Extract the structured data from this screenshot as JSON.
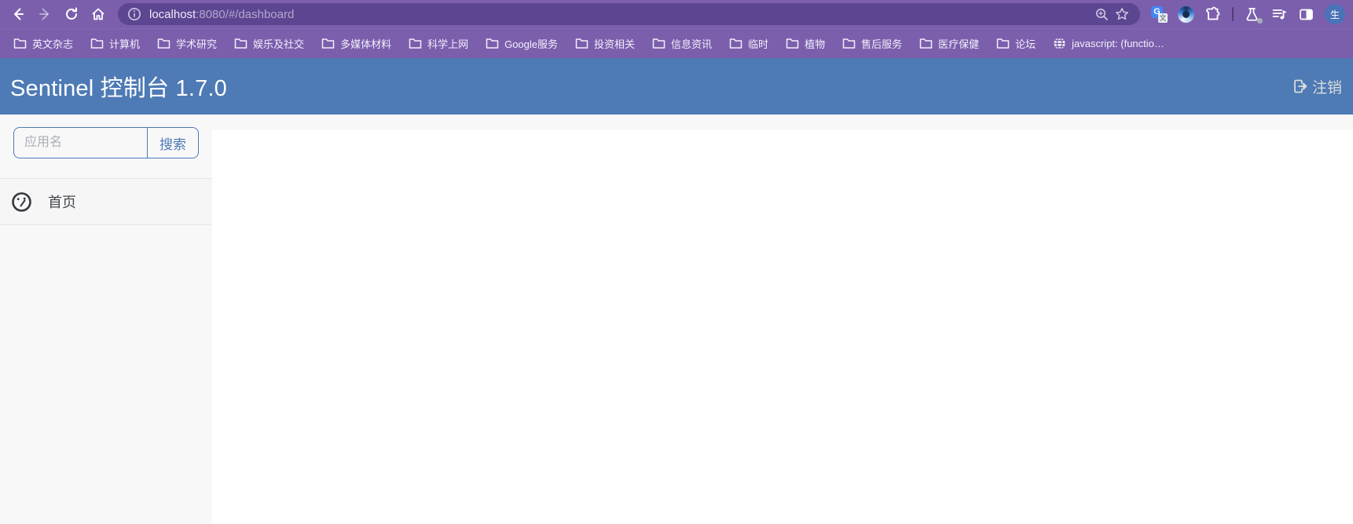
{
  "browser": {
    "url": {
      "host": "localhost",
      "rest": ":8080/#/dashboard"
    },
    "avatar_text": "生",
    "bookmarks": [
      {
        "label": "英文杂志"
      },
      {
        "label": "计算机"
      },
      {
        "label": "学术研究"
      },
      {
        "label": "娱乐及社交"
      },
      {
        "label": "多媒体材料"
      },
      {
        "label": "科学上网"
      },
      {
        "label": "Google服务"
      },
      {
        "label": "投资相关"
      },
      {
        "label": "信息资讯"
      },
      {
        "label": "临时"
      },
      {
        "label": "植物"
      },
      {
        "label": "售后服务"
      },
      {
        "label": "医疗保健"
      },
      {
        "label": "论坛"
      },
      {
        "label": "javascript: (functio…"
      }
    ]
  },
  "app": {
    "title": "Sentinel 控制台 1.7.0",
    "logout_label": "注销",
    "sidebar": {
      "search_placeholder": "应用名",
      "search_button_label": "搜索",
      "nav": [
        {
          "label": "首页"
        }
      ]
    }
  },
  "colors": {
    "toolbar_purple": "#7b5fad",
    "omnibox_purple": "#5d4691",
    "header_blue": "#4e7ab5",
    "accent_blue": "#4e79b6",
    "sidebar_bg": "#f8f8f8",
    "logout_text": "#d9ded9",
    "translate_blue": "#4285f4"
  }
}
